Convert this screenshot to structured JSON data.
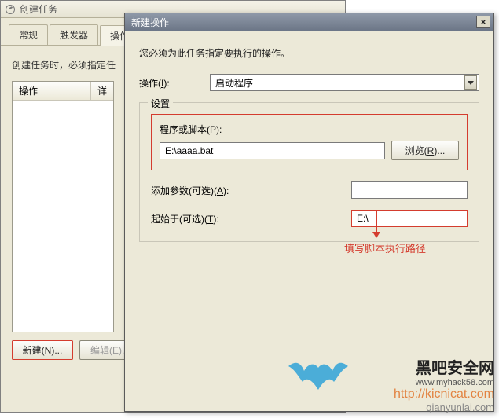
{
  "back_window": {
    "title": "创建任务",
    "tabs": [
      "常规",
      "触发器",
      "操作"
    ],
    "hint_partial": "创建任务时，必须指定任",
    "columns": {
      "op": "操作",
      "detail": "详"
    },
    "buttons": {
      "new": "新建(N)...",
      "edit": "编辑(E)..."
    }
  },
  "front_window": {
    "title": "新建操作",
    "instruction": "您必须为此任务指定要执行的操作。",
    "action_label_pre": "操作(",
    "action_label_u": "I",
    "action_label_post": "):",
    "action_value": "启动程序",
    "group_legend": "设置",
    "program_label_pre": "程序或脚本(",
    "program_label_u": "P",
    "program_label_post": "):",
    "program_value": "E:\\aaaa.bat",
    "browse_pre": "浏览(",
    "browse_u": "R",
    "browse_post": ")...",
    "args_label_pre": "添加参数(可选)(",
    "args_label_u": "A",
    "args_label_post": "):",
    "args_value": "",
    "startin_label_pre": "起始于(可选)(",
    "startin_label_u": "T",
    "startin_label_post": "):",
    "startin_value": "E:\\"
  },
  "annotation": {
    "text": "填写脚本执行路径"
  },
  "watermark": {
    "line1": "黑吧安全网",
    "line2": "www.myhack58.com",
    "line3": "http://kicnicat.com",
    "line4": "qianyunlai.com"
  }
}
